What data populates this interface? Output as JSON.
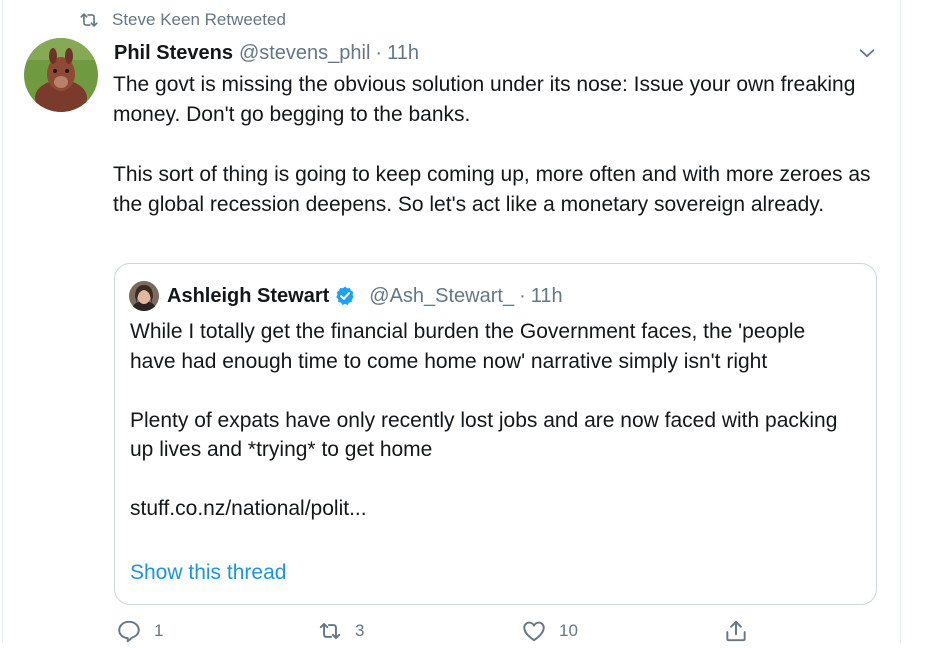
{
  "retweet_context": {
    "icon": "retweet-icon",
    "text": "Steve Keen Retweeted"
  },
  "tweet": {
    "author_name": "Phil Stevens",
    "author_handle": "@stevens_phil",
    "separator": "·",
    "time": "11h",
    "paragraphs": [
      "The govt is missing the obvious solution under its nose: Issue your own freaking money. Don't go begging to the banks.",
      "This sort of thing is going to keep coming up, more often and with more zeroes as the global recession deepens. So let's act like a monetary sovereign already."
    ]
  },
  "quoted": {
    "author_name": "Ashleigh Stewart",
    "verified": true,
    "author_handle": "@Ash_Stewart_",
    "separator": "·",
    "time": "11h",
    "paragraphs": [
      "While I totally get the financial burden the Government faces, the 'people have had enough time to come home now'  narrative simply isn't right",
      "Plenty of expats have only recently lost jobs and are now faced with packing up lives and *trying* to get home",
      "stuff.co.nz/national/polit..."
    ],
    "show_thread": "Show this thread"
  },
  "actions": {
    "reply_count": "1",
    "retweet_count": "3",
    "like_count": "10"
  },
  "colors": {
    "text": "#14171a",
    "secondary": "#657786",
    "link": "#1b95e0",
    "border": "#ccd6dd",
    "verified": "#1da1f2"
  }
}
